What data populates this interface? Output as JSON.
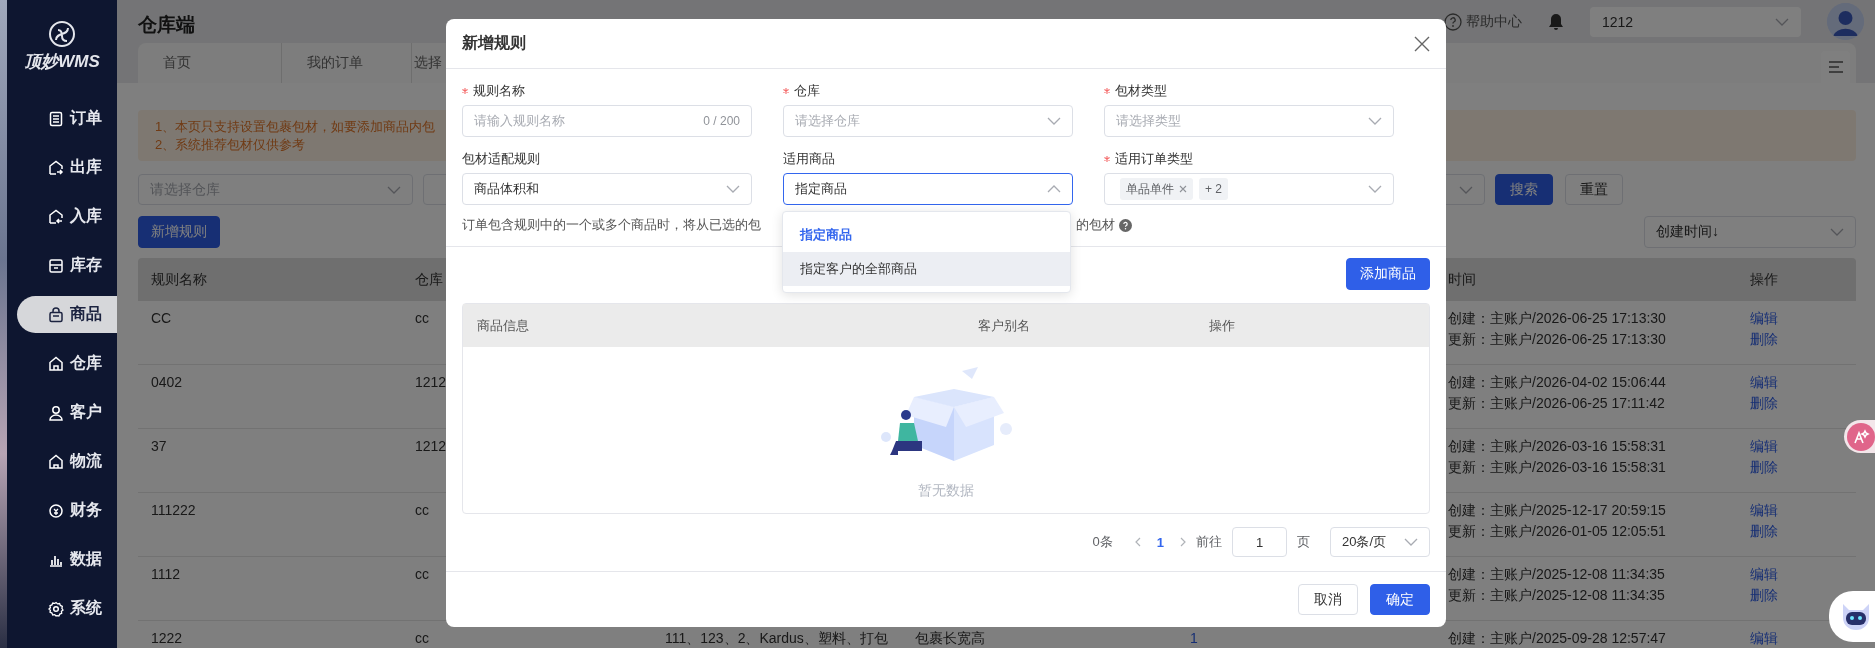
{
  "sidebar": {
    "logo": "顶妙WMS",
    "items": [
      {
        "label": "订单",
        "selected": false
      },
      {
        "label": "出库",
        "selected": false
      },
      {
        "label": "入库",
        "selected": false
      },
      {
        "label": "库存",
        "selected": false
      },
      {
        "label": "商品",
        "selected": true
      },
      {
        "label": "仓库",
        "selected": false
      },
      {
        "label": "客户",
        "selected": false
      },
      {
        "label": "物流",
        "selected": false
      },
      {
        "label": "财务",
        "selected": false
      },
      {
        "label": "数据",
        "selected": false
      },
      {
        "label": "系统",
        "selected": false
      }
    ]
  },
  "header": {
    "title": "仓库端",
    "help": "帮助中心",
    "account": "1212",
    "tabs": [
      {
        "label": "首页",
        "selected": false
      },
      {
        "label": "我的订单",
        "selected": false
      },
      {
        "label": "选择",
        "selected": false
      }
    ]
  },
  "notice": [
    "1、本页只支持设置包裹包材，如要添加商品内包",
    "2、系统推荐包材仅供参考"
  ],
  "filters": {
    "warehouse_placeholder": "请选择仓库",
    "search_button": "搜索",
    "reset_button": "重置"
  },
  "new_rule_button": "新增规则",
  "sort": "创建时间↓",
  "table": {
    "columns": [
      {
        "label": "规则名称"
      },
      {
        "label": "仓库"
      },
      {},
      {},
      {},
      {
        "label": "时间"
      },
      {
        "label": "操作"
      }
    ],
    "rows": [
      {
        "name": "CC",
        "warehouse": "cc",
        "created": "创建：主账户/2026-06-25 17:13:30",
        "updated": "更新：主账户/2026-06-25 17:13:30",
        "actions": [
          "编辑",
          "删除"
        ]
      },
      {
        "name": "0402",
        "warehouse": "1212",
        "created": "创建：主账户/2026-04-02 15:06:44",
        "updated": "更新：主账户/2026-06-25 17:11:42",
        "actions": [
          "编辑",
          "删除"
        ]
      },
      {
        "name": "37",
        "warehouse": "1212",
        "created": "创建：主账户/2026-03-16 15:58:31",
        "updated": "更新：主账户/2026-03-16 15:58:31",
        "actions": [
          "编辑",
          "删除"
        ]
      },
      {
        "name": "111222",
        "warehouse": "cc",
        "created": "创建：主账户/2025-12-17 20:59:15",
        "updated": "更新：主账户/2026-01-05 12:05:51",
        "actions": [
          "编辑",
          "删除"
        ]
      },
      {
        "name": "1112",
        "warehouse": "cc",
        "created": "创建：主账户/2025-12-08 11:34:35",
        "updated": "更新：主账户/2025-12-08 11:34:35",
        "actions": [
          "编辑",
          "删除"
        ]
      },
      {
        "name": "1222",
        "warehouse": "cc",
        "column_3": "111、123、2、Kardus、塑料、打包",
        "column_4": "包裹长宽高",
        "column_5": "1",
        "created": "创建：主账户/2025-09-28 12:57:47",
        "actions": [
          "编辑"
        ]
      }
    ]
  },
  "modal": {
    "title": "新增规则",
    "fields": [
      {
        "label": "规则名称",
        "required": true,
        "kind": "text",
        "placeholder": "请输入规则名称",
        "counter": "0 / 200"
      },
      {
        "label": "仓库",
        "required": true,
        "kind": "select",
        "placeholder": "请选择仓库",
        "open": false
      },
      {
        "label": "包材类型",
        "required": true,
        "kind": "select",
        "placeholder": "请选择类型",
        "open": false
      },
      {
        "label": "包材适配规则",
        "required": false,
        "kind": "select",
        "value": "商品体积和",
        "open": false
      },
      {
        "label": "适用商品",
        "required": false,
        "kind": "select",
        "value": "指定商品",
        "open": true,
        "options": [
          {
            "label": "指定商品",
            "selected": true,
            "hovered": false
          },
          {
            "label": "指定客户的全部商品",
            "selected": false,
            "hovered": true
          }
        ]
      },
      {
        "label": "适用订单类型",
        "required": true,
        "kind": "tags",
        "tags": [
          "单品单件"
        ],
        "more": "+ 2",
        "open": false
      }
    ],
    "hint_start": "订单包含规则中的一个或多个商品时，将从已选的包",
    "hint_end": "的包材",
    "add_button": "添加商品",
    "table": {
      "columns": [
        "商品信息",
        "客户别名",
        "操作"
      ],
      "empty_text": "暂无数据"
    },
    "pagination": {
      "total": "0条",
      "pages": [
        {
          "label": "1",
          "selected": true
        }
      ],
      "goto_label": "前往",
      "goto_value": "1",
      "page_unit": "页",
      "page_size": "20条/页"
    },
    "buttons": [
      {
        "label": "取消",
        "kind": "secondary"
      },
      {
        "label": "确定",
        "kind": "primary"
      }
    ]
  }
}
